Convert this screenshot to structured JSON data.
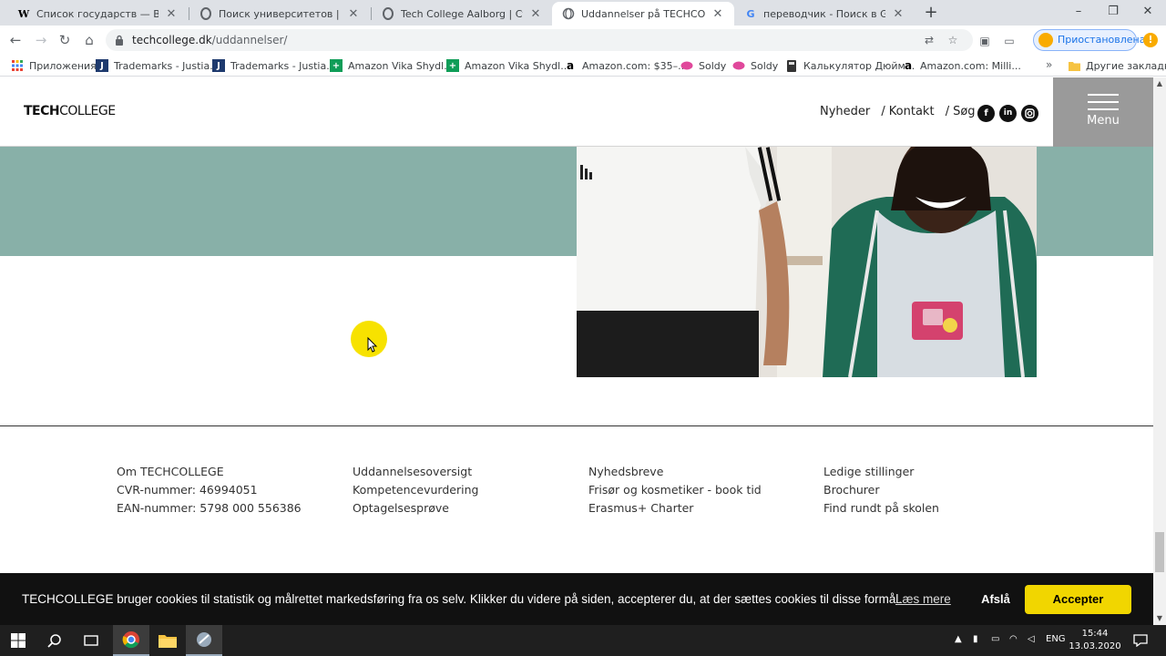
{
  "browser": {
    "tabs": [
      {
        "title": "Список государств — Википеди",
        "favicon": "W"
      },
      {
        "title": "Поиск университетов | Рейтинг",
        "favicon": "opera-icon"
      },
      {
        "title": "Tech College Aalborg | Стоимост",
        "favicon": "opera-icon"
      },
      {
        "title": "Uddannelser på TECHCOLLEGE -",
        "favicon": "globe-icon"
      },
      {
        "title": "переводчик - Поиск в Google",
        "favicon": "G"
      }
    ],
    "url_host": "techcollege.dk",
    "url_path": "/uddannelser/",
    "profile_label": "Приостановлена",
    "update_badge": "!"
  },
  "bookmarks": [
    {
      "label": "Приложения",
      "icon": "apps-icon"
    },
    {
      "label": "Trademarks - Justia...",
      "icon": "J"
    },
    {
      "label": "Trademarks - Justia...",
      "icon": "J"
    },
    {
      "label": "Amazon Vika Shydl...",
      "icon": "sheets-icon"
    },
    {
      "label": "Amazon Vika Shydl...",
      "icon": "sheets-icon"
    },
    {
      "label": "Amazon.com: $35–...",
      "icon": "a"
    },
    {
      "label": "Soldy",
      "icon": "soldy-icon"
    },
    {
      "label": "Soldy",
      "icon": "soldy-icon"
    },
    {
      "label": "Калькулятор Дюйм...",
      "icon": "calculator-icon"
    },
    {
      "label": "Amazon.com: Milli...",
      "icon": "a"
    }
  ],
  "bookmarks_more": "»",
  "other_bookmarks": "Другие закладки",
  "site": {
    "logo_bold": "TECH",
    "logo_rest": "COLLEGE",
    "nav": [
      "Nyheder",
      "Kontakt",
      "Søg"
    ],
    "nav_sep": "/",
    "social": [
      "f",
      "in",
      "ig"
    ],
    "menu_label": "Menu"
  },
  "footer": {
    "col1": [
      "Om TECHCOLLEGE",
      "CVR-nummer: 46994051",
      "EAN-nummer: 5798 000 556386"
    ],
    "col2": [
      "Uddannelsesoversigt",
      "Kompetencevurdering",
      "Optagelsesprøve"
    ],
    "col3": [
      "Nyhedsbreve",
      "Frisør og kosmetiker - book tid",
      "Erasmus+ Charter"
    ],
    "col4": [
      "Ledige stillinger",
      "Brochurer",
      "Find rundt på skolen"
    ]
  },
  "cookie": {
    "text": "TECHCOLLEGE bruger cookies til statistik og målrettet markedsføring fra os selv. Klikker du videre på siden, accepterer du, at der sættes cookies til disse formål.",
    "learn_more": "Læs mere",
    "decline": "Afslå",
    "accept": "Accepter"
  },
  "taskbar": {
    "lang": "ENG",
    "time": "15:44",
    "date": "13.03.2020"
  },
  "colors": {
    "teal": "#88b0a8",
    "menu_bg": "#9a9a9a",
    "accept_bg": "#f1d600",
    "cookie_bg": "#111111"
  }
}
